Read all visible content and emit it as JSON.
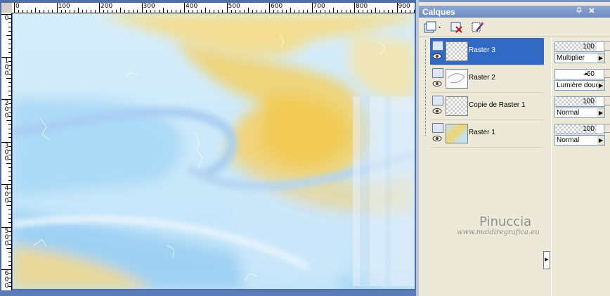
{
  "ruler": {
    "horizontal_labels": [
      "0",
      "100",
      "200",
      "300",
      "400",
      "500",
      "600",
      "700",
      "800",
      "900"
    ],
    "vertical_labels": [
      "0",
      "1\n0\n0",
      "2\n0\n0",
      "3\n0\n0",
      "4\n0\n0",
      "5\n0\n0",
      "6\n0\n0"
    ]
  },
  "palette": {
    "title": "Calques",
    "pin_icon": "pin-icon",
    "close_icon": "close-icon"
  },
  "layers": [
    {
      "name": "Raster 3",
      "selected": true,
      "opacity": "100",
      "blend_mode": "Multiplier"
    },
    {
      "name": "Raster 2",
      "selected": false,
      "opacity": "60",
      "blend_mode": "Lumière douce"
    },
    {
      "name": "Copie de Raster 1",
      "selected": false,
      "opacity": "100",
      "blend_mode": "Normal"
    },
    {
      "name": "Raster 1",
      "selected": false,
      "opacity": "100",
      "blend_mode": "Normal"
    }
  ],
  "watermark": {
    "name": "Pinuccia",
    "url": "www.maidiregrafica.eu"
  },
  "colors": {
    "selection": "#316ac5",
    "palette_bg": "#ece9d8",
    "title_bar": "#7a96c6"
  }
}
